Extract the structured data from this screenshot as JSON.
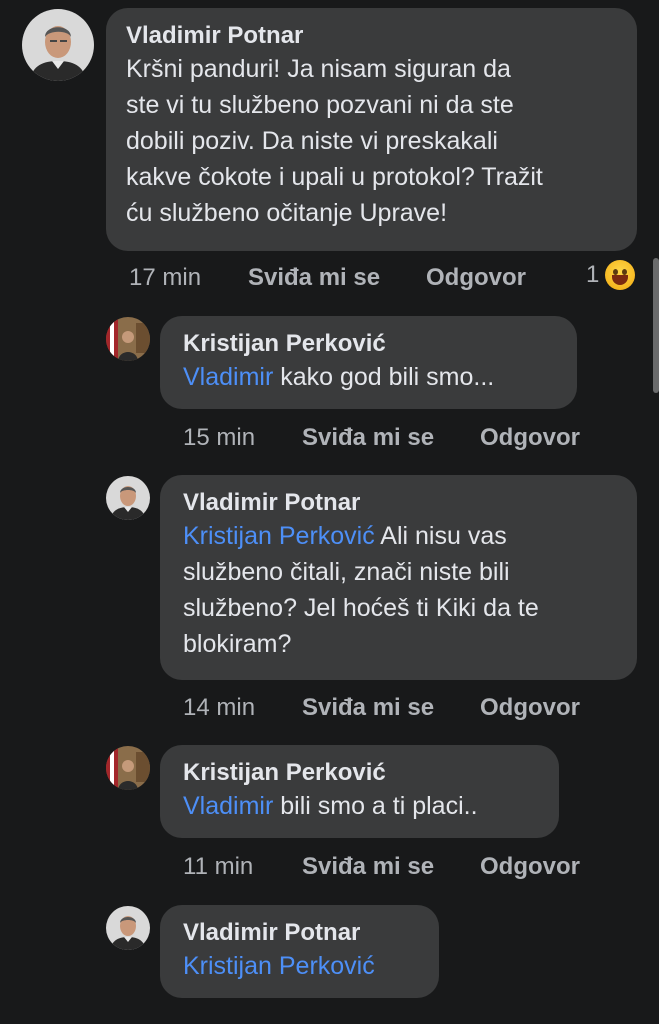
{
  "comments": [
    {
      "author": "Vladimir Potnar",
      "lines": [
        "Kršni panduri! Ja nisam siguran da",
        "ste vi tu službeno pozvani ni da ste",
        "dobili poziv. Da niste vi preskakali",
        "kakve čokote i upali u protokol? Tražit",
        "ću službeno očitanje Uprave!"
      ],
      "time": "17 min",
      "like_label": "Sviđa mi se",
      "reply_label": "Odgovor",
      "reaction_count": "1",
      "reaction_icon": "grinning-emoji-icon"
    },
    {
      "author": "Kristijan Perković",
      "mention": "Vladimir",
      "text": " kako god bili smo...",
      "time": "15 min",
      "like_label": "Sviđa mi se",
      "reply_label": "Odgovor"
    },
    {
      "author": "Vladimir Potnar",
      "mention": "Kristijan Perković",
      "first_line_rest": " Ali nisu vas",
      "lines": [
        "službeno čitali, znači niste bili",
        "službeno? Jel hoćeš ti Kiki da te",
        "blokiram?"
      ],
      "time": "14 min",
      "like_label": "Sviđa mi se",
      "reply_label": "Odgovor"
    },
    {
      "author": "Kristijan Perković",
      "mention": "Vladimir",
      "text": " bili smo a ti placi..",
      "time": "11 min",
      "like_label": "Sviđa mi se",
      "reply_label": "Odgovor"
    },
    {
      "author": "Vladimir Potnar",
      "mention": "Kristijan Perković"
    }
  ],
  "colors": {
    "background": "#18191a",
    "bubble": "#3a3b3c",
    "mention": "#4d8ff7",
    "secondary_text": "#b0b3b8"
  }
}
